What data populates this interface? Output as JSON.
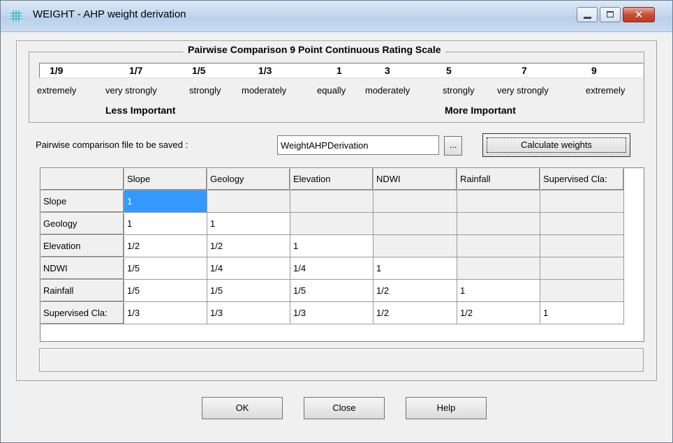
{
  "window": {
    "title": "WEIGHT - AHP weight derivation"
  },
  "scale": {
    "title": "Pairwise Comparison 9 Point Continuous Rating Scale",
    "values": [
      "1/9",
      "1/7",
      "1/5",
      "1/3",
      "1",
      "3",
      "5",
      "7",
      "9"
    ],
    "words": [
      "extremely",
      "very strongly",
      "strongly",
      "moderately",
      "equally",
      "moderately",
      "strongly",
      "very strongly",
      "extremely"
    ],
    "less_label": "Less Important",
    "more_label": "More Important"
  },
  "file": {
    "label": "Pairwise comparison file to be saved :",
    "value": "WeightAHPDerivation",
    "browse_label": "...",
    "calculate_label": "Calculate weights"
  },
  "grid": {
    "columns": [
      "Slope",
      "Geology",
      "Elevation",
      "NDWI",
      "Rainfall",
      "Supervised Cla:"
    ],
    "rows": [
      {
        "label": "Slope",
        "cells": [
          "1",
          "",
          "",
          "",
          "",
          ""
        ]
      },
      {
        "label": "Geology",
        "cells": [
          "1",
          "1",
          "",
          "",
          "",
          ""
        ]
      },
      {
        "label": "Elevation",
        "cells": [
          "1/2",
          "1/2",
          "1",
          "",
          "",
          ""
        ]
      },
      {
        "label": "NDWI",
        "cells": [
          "1/5",
          "1/4",
          "1/4",
          "1",
          "",
          ""
        ]
      },
      {
        "label": "Rainfall",
        "cells": [
          "1/5",
          "1/5",
          "1/5",
          "1/2",
          "1",
          ""
        ]
      },
      {
        "label": "Supervised Cla:",
        "cells": [
          "1/3",
          "1/3",
          "1/3",
          "1/2",
          "1/2",
          "1"
        ]
      }
    ],
    "selected_cell": [
      0,
      0
    ]
  },
  "buttons": {
    "ok": "OK",
    "close": "Close",
    "help": "Help"
  },
  "colors": {
    "selection": "#3399ff",
    "titlebar": "#c6d9f0",
    "close_button": "#c74d37"
  }
}
